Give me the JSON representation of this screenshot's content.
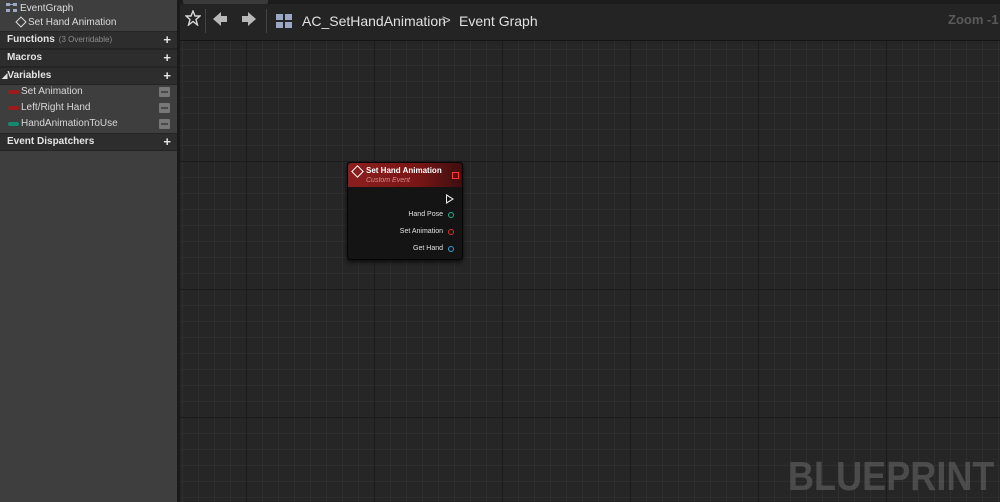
{
  "sidebar": {
    "graphs": {
      "event_graph_label": "EventGraph",
      "event_label": "Set Hand Animation"
    },
    "functions": {
      "label": "Functions",
      "count_text": "(3 Overridable)",
      "add": "+"
    },
    "macros": {
      "label": "Macros",
      "add": "+"
    },
    "variables": {
      "label": "Variables",
      "add": "+",
      "items": [
        {
          "label": "Set Animation",
          "color": "#9b1c1c"
        },
        {
          "label": "Left/Right Hand",
          "color": "#9b1c1c"
        },
        {
          "label": "HandAnimationToUse",
          "color": "#138a6f"
        }
      ]
    },
    "event_dispatchers": {
      "label": "Event Dispatchers",
      "add": "+"
    }
  },
  "toolbar": {
    "favorite_icon": "star-icon",
    "back_icon": "back-arrow-icon",
    "forward_icon": "forward-arrow-icon",
    "blueprint_name": "AC_SetHandAnimation",
    "separator": ">",
    "graph_name": "Event Graph",
    "zoom": "Zoom -1"
  },
  "node": {
    "title": "Set Hand Animation",
    "subtitle": "Custom Event",
    "pins": [
      {
        "label": "Hand Pose",
        "color": "#1fb08a"
      },
      {
        "label": "Set Animation",
        "color": "#e0302a"
      },
      {
        "label": "Get Hand",
        "color": "#2aa5d8"
      }
    ]
  },
  "watermark": "BLUEPRINT"
}
